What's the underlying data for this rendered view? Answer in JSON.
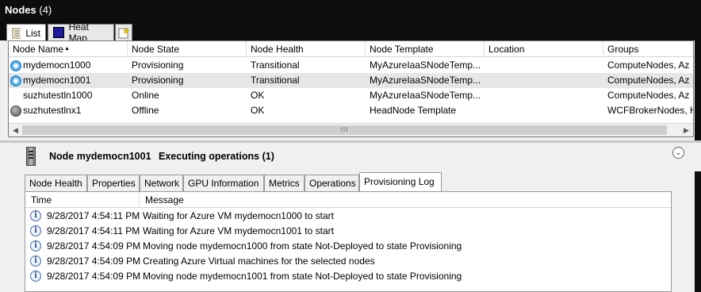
{
  "window": {
    "title": "Nodes",
    "count": "(4)"
  },
  "view_tabs": [
    {
      "label": "List",
      "icon": "list-icon"
    },
    {
      "label": "Heat Map",
      "icon": "heatmap-icon"
    },
    {
      "label": "",
      "icon": "new-view-icon"
    }
  ],
  "grid": {
    "columns": [
      "Node Name",
      "Node State",
      "Node Health",
      "Node Template",
      "Location",
      "Groups"
    ],
    "sort_column": "Node Name",
    "rows": [
      {
        "icon": "provisioning-icon",
        "name": "mydemocn1000",
        "state": "Provisioning",
        "health": "Transitional",
        "template": "MyAzureIaaSNodeTemp...",
        "location": "",
        "groups": "ComputeNodes, Az"
      },
      {
        "icon": "provisioning-icon",
        "name": "mydemocn1001",
        "state": "Provisioning",
        "health": "Transitional",
        "template": "MyAzureIaaSNodeTemp...",
        "location": "",
        "groups": "ComputeNodes, Az",
        "selected": true
      },
      {
        "icon": "",
        "name": "suzhutestln1000",
        "state": "Online",
        "health": "OK",
        "template": "MyAzureIaaSNodeTemp...",
        "location": "",
        "groups": "ComputeNodes, Az"
      },
      {
        "icon": "offline-icon",
        "name": "suzhutestlnx1",
        "state": "Offline",
        "health": "OK",
        "template": "HeadNode Template",
        "location": "",
        "groups": "WCFBrokerNodes, H"
      }
    ],
    "scrollbar_grip": "III"
  },
  "details": {
    "title": "Node mydemocn1001",
    "status": "Executing operations (1)",
    "tabs": [
      "Node Health",
      "Properties",
      "Network",
      "GPU Information",
      "Metrics",
      "Operations",
      "Provisioning Log"
    ],
    "active_tab": "Provisioning Log",
    "log": {
      "columns": [
        "Time",
        "Message"
      ],
      "rows": [
        {
          "time": "9/28/2017 4:54:11 PM",
          "message": "Waiting for Azure VM mydemocn1000 to start"
        },
        {
          "time": "9/28/2017 4:54:11 PM",
          "message": "Waiting for Azure VM mydemocn1001 to start"
        },
        {
          "time": "9/28/2017 4:54:09 PM",
          "message": "Moving node mydemocn1000 from state Not-Deployed to state Provisioning"
        },
        {
          "time": "9/28/2017 4:54:09 PM",
          "message": "Creating Azure Virtual machines for the selected nodes"
        },
        {
          "time": "9/28/2017 4:54:09 PM",
          "message": "Moving node mydemocn1001 from state Not-Deployed to state Provisioning"
        }
      ]
    }
  },
  "colors": {
    "title_bar": "#0d0d0d",
    "selected_row": "#e6e6e6",
    "provisioning_icon": "#2b8fd6",
    "info_icon": "#4a6ea8"
  }
}
